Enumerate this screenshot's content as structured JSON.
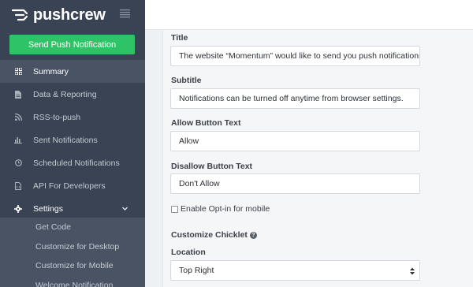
{
  "brand": {
    "name": "pushcrew"
  },
  "sidebar": {
    "push_button": "Send Push Notification",
    "items": [
      {
        "label": "Summary",
        "icon": "grid-icon"
      },
      {
        "label": "Data & Reporting",
        "icon": "document-icon"
      },
      {
        "label": "RSS-to-push",
        "icon": "rss-icon"
      },
      {
        "label": "Sent Notifications",
        "icon": "bar-chart-icon"
      },
      {
        "label": "Scheduled Notifications",
        "icon": "clock-icon"
      },
      {
        "label": "API For Developers",
        "icon": "code-file-icon"
      },
      {
        "label": "Settings",
        "icon": "gear-icon"
      }
    ],
    "subitems": [
      {
        "label": "Get Code"
      },
      {
        "label": "Customize for Desktop"
      },
      {
        "label": "Customize for Mobile"
      },
      {
        "label": "Welcome Notification"
      }
    ]
  },
  "form": {
    "title_label": "Title",
    "title_value": "The website “Momentum” would like to send you push notifications.",
    "subtitle_label": "Subtitle",
    "subtitle_value": "Notifications can be turned off anytime from browser settings.",
    "allow_label": "Allow Button Text",
    "allow_value": "Allow",
    "disallow_label": "Disallow Button Text",
    "disallow_value": "Don't Allow",
    "optin_label": "Enable Opt-in for mobile",
    "optin_checked": false,
    "chicklet_label": "Customize Chicklet",
    "location_label": "Location",
    "location_value": "Top Right"
  },
  "colors": {
    "sidebar_bg": "#3a4353",
    "active_bg": "#4a5364",
    "accent_green": "#2ec366"
  }
}
